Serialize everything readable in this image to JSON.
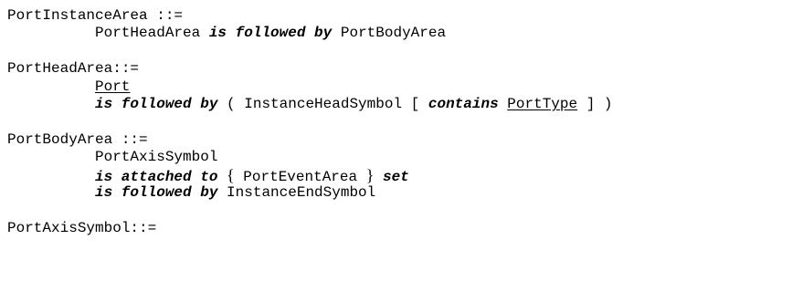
{
  "grammar": {
    "port_instance_area": {
      "def": "PortInstanceArea ::=",
      "head_area": "PortHeadArea",
      "kw_followed": "is followed by",
      "body_area": "PortBodyArea"
    },
    "port_head_area": {
      "def": "PortHeadArea::=",
      "port": "Port",
      "kw_followed": "is followed by",
      "open": "( InstanceHeadSymbol [",
      "kw_contains": "contains",
      "port_type": "PortType",
      "close": "] )"
    },
    "port_body_area": {
      "def": "PortBodyArea ::=",
      "axis": "PortAxisSymbol",
      "kw_attached": "is attached to",
      "brace_open": "{",
      "event_area": "PortEventArea",
      "brace_close": "}",
      "kw_set": "set",
      "kw_followed": "is followed by",
      "end_symbol": "InstanceEndSymbol"
    },
    "port_axis_symbol": {
      "def": "PortAxisSymbol::="
    }
  }
}
